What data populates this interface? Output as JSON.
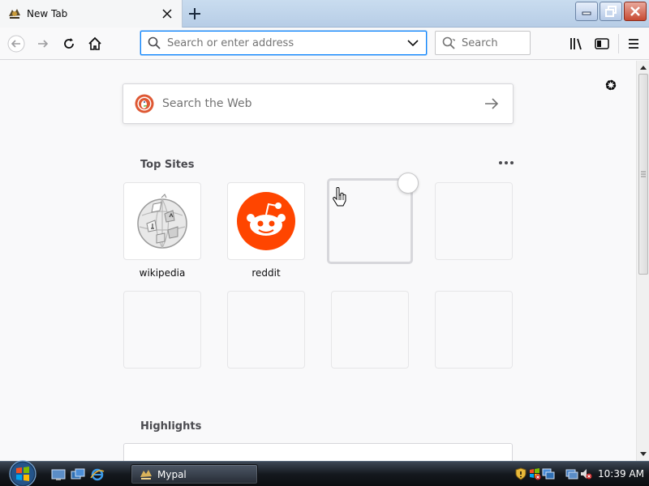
{
  "tab": {
    "title": "New Tab",
    "close_icon": "close-icon",
    "favicon": "mypal-favicon"
  },
  "window_controls": [
    "minimize",
    "restore",
    "close"
  ],
  "navbar": {
    "back_icon": "back-arrow-icon",
    "forward_icon": "forward-arrow-icon",
    "reload_icon": "reload-icon",
    "home_icon": "home-icon",
    "urlbar_placeholder": "Search or enter address",
    "urlbar_value": "",
    "searchbar_placeholder": "Search",
    "library_icon": "library-icon",
    "sidebar_icon": "sidebar-icon",
    "menu_icon": "hamburger-menu-icon"
  },
  "newtab": {
    "websearch_placeholder": "Search the Web",
    "top_sites_title": "Top Sites",
    "highlights_title": "Highlights",
    "tiles": [
      {
        "label": "wikipedia",
        "icon": "wikipedia-globe-icon"
      },
      {
        "label": "reddit",
        "icon": "reddit-alien-icon"
      },
      {
        "label": "",
        "icon": ""
      },
      {
        "label": "",
        "icon": ""
      },
      {
        "label": "",
        "icon": ""
      },
      {
        "label": "",
        "icon": ""
      },
      {
        "label": "",
        "icon": ""
      },
      {
        "label": "",
        "icon": ""
      }
    ]
  },
  "taskbar": {
    "task_label": "Mypal",
    "clock": "10:39 AM"
  },
  "colors": {
    "accent": "#0a84ff",
    "reddit": "#ff4500",
    "duckduckgo": "#de5833",
    "close_button": "#c74a33"
  }
}
